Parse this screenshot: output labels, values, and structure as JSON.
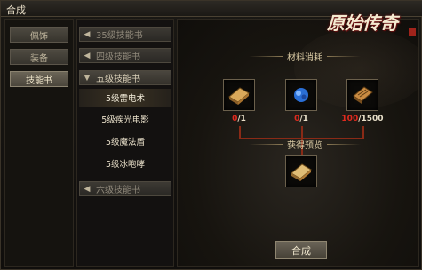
{
  "window": {
    "title": "合成",
    "logo_text": "原始传奇"
  },
  "left_tabs": [
    {
      "label": "佩饰",
      "active": false
    },
    {
      "label": "装备",
      "active": false
    },
    {
      "label": "技能书",
      "active": true
    }
  ],
  "categories": {
    "book35": "35级技能书",
    "book4": "四级技能书",
    "book5": "五级技能书",
    "book5_items": [
      "5级雷电术",
      "5级疾光电影",
      "5级魔法盾",
      "5级冰咆哮"
    ],
    "book6": "六级技能书"
  },
  "main": {
    "materials_title": "材料消耗",
    "result_title": "获得预览",
    "materials": [
      {
        "icon": "book-icon",
        "have": "0",
        "need": "/1"
      },
      {
        "icon": "blue-gem-icon",
        "have": "0",
        "need": "/1"
      },
      {
        "icon": "scroll-icon",
        "have": "100",
        "need": "/1500"
      }
    ],
    "result_icon": "skill-book-icon",
    "merge_button": "合成"
  },
  "colors": {
    "accent_red": "#e02a1e",
    "gold": "#d7c8a2"
  }
}
